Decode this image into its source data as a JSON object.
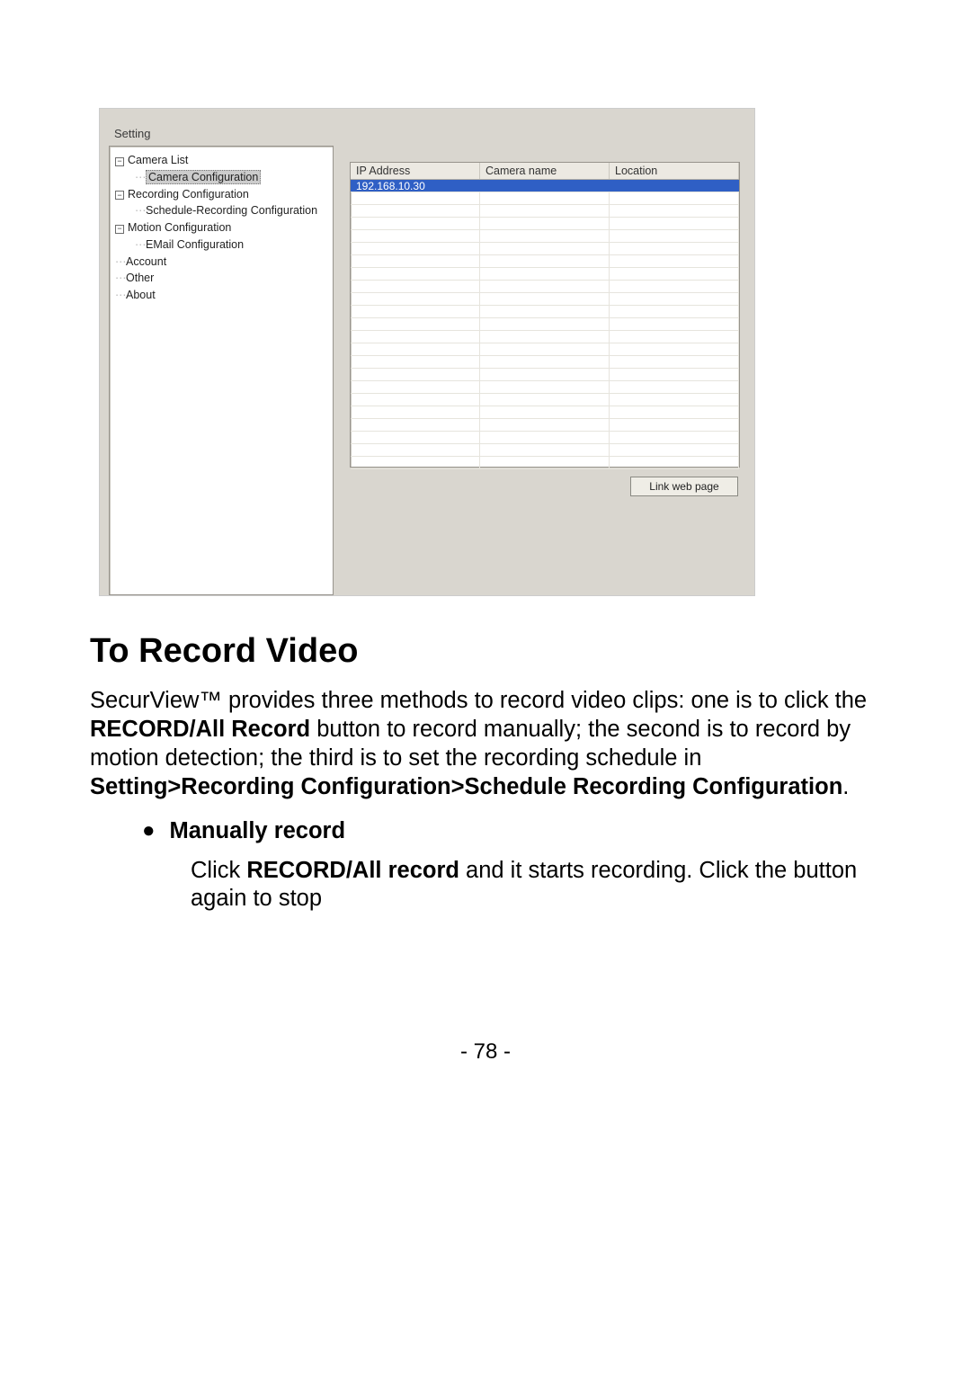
{
  "screenshot": {
    "caption": "Setting",
    "tree": {
      "items": [
        {
          "level": 0,
          "toggle": "−",
          "label": "Camera List",
          "sel": false
        },
        {
          "level": 1,
          "toggle": "",
          "label": "Camera Configuration",
          "sel": true
        },
        {
          "level": 0,
          "toggle": "−",
          "label": "Recording Configuration",
          "sel": false
        },
        {
          "level": 1,
          "toggle": "",
          "label": "Schedule-Recording Configuration",
          "sel": false
        },
        {
          "level": 0,
          "toggle": "−",
          "label": "Motion Configuration",
          "sel": false
        },
        {
          "level": 1,
          "toggle": "",
          "label": "EMail Configuration",
          "sel": false
        },
        {
          "level": 0,
          "toggle": "",
          "label": "Account",
          "sel": false
        },
        {
          "level": 0,
          "toggle": "",
          "label": "Other",
          "sel": false
        },
        {
          "level": 0,
          "toggle": "",
          "label": "About",
          "sel": false
        }
      ]
    },
    "grid": {
      "headers": [
        "IP Address",
        "Camera name",
        "Location"
      ],
      "rows": [
        {
          "cells": [
            "192.168.10.30",
            "",
            ""
          ],
          "sel": true
        }
      ],
      "blank_rows": 22
    },
    "button_label": "Link web page"
  },
  "doc": {
    "heading": "To Record Video",
    "para_parts": {
      "p1a": "SecurView™ provides three methods to record video clips: one is to click the ",
      "p1b": "RECORD/All Record",
      "p1c": " button to record manually; the second is to record by motion detection;  the third is to set the recording schedule in ",
      "p1d": "Setting>Recording Configuration>Schedule Recording Configuration",
      "p1e": "."
    },
    "bullet": {
      "title": "Manually record",
      "body_a": "Click ",
      "body_b": "RECORD/All record",
      "body_c": " and it starts recording.  Click the button again to stop"
    },
    "page_num": "- 78 -"
  }
}
